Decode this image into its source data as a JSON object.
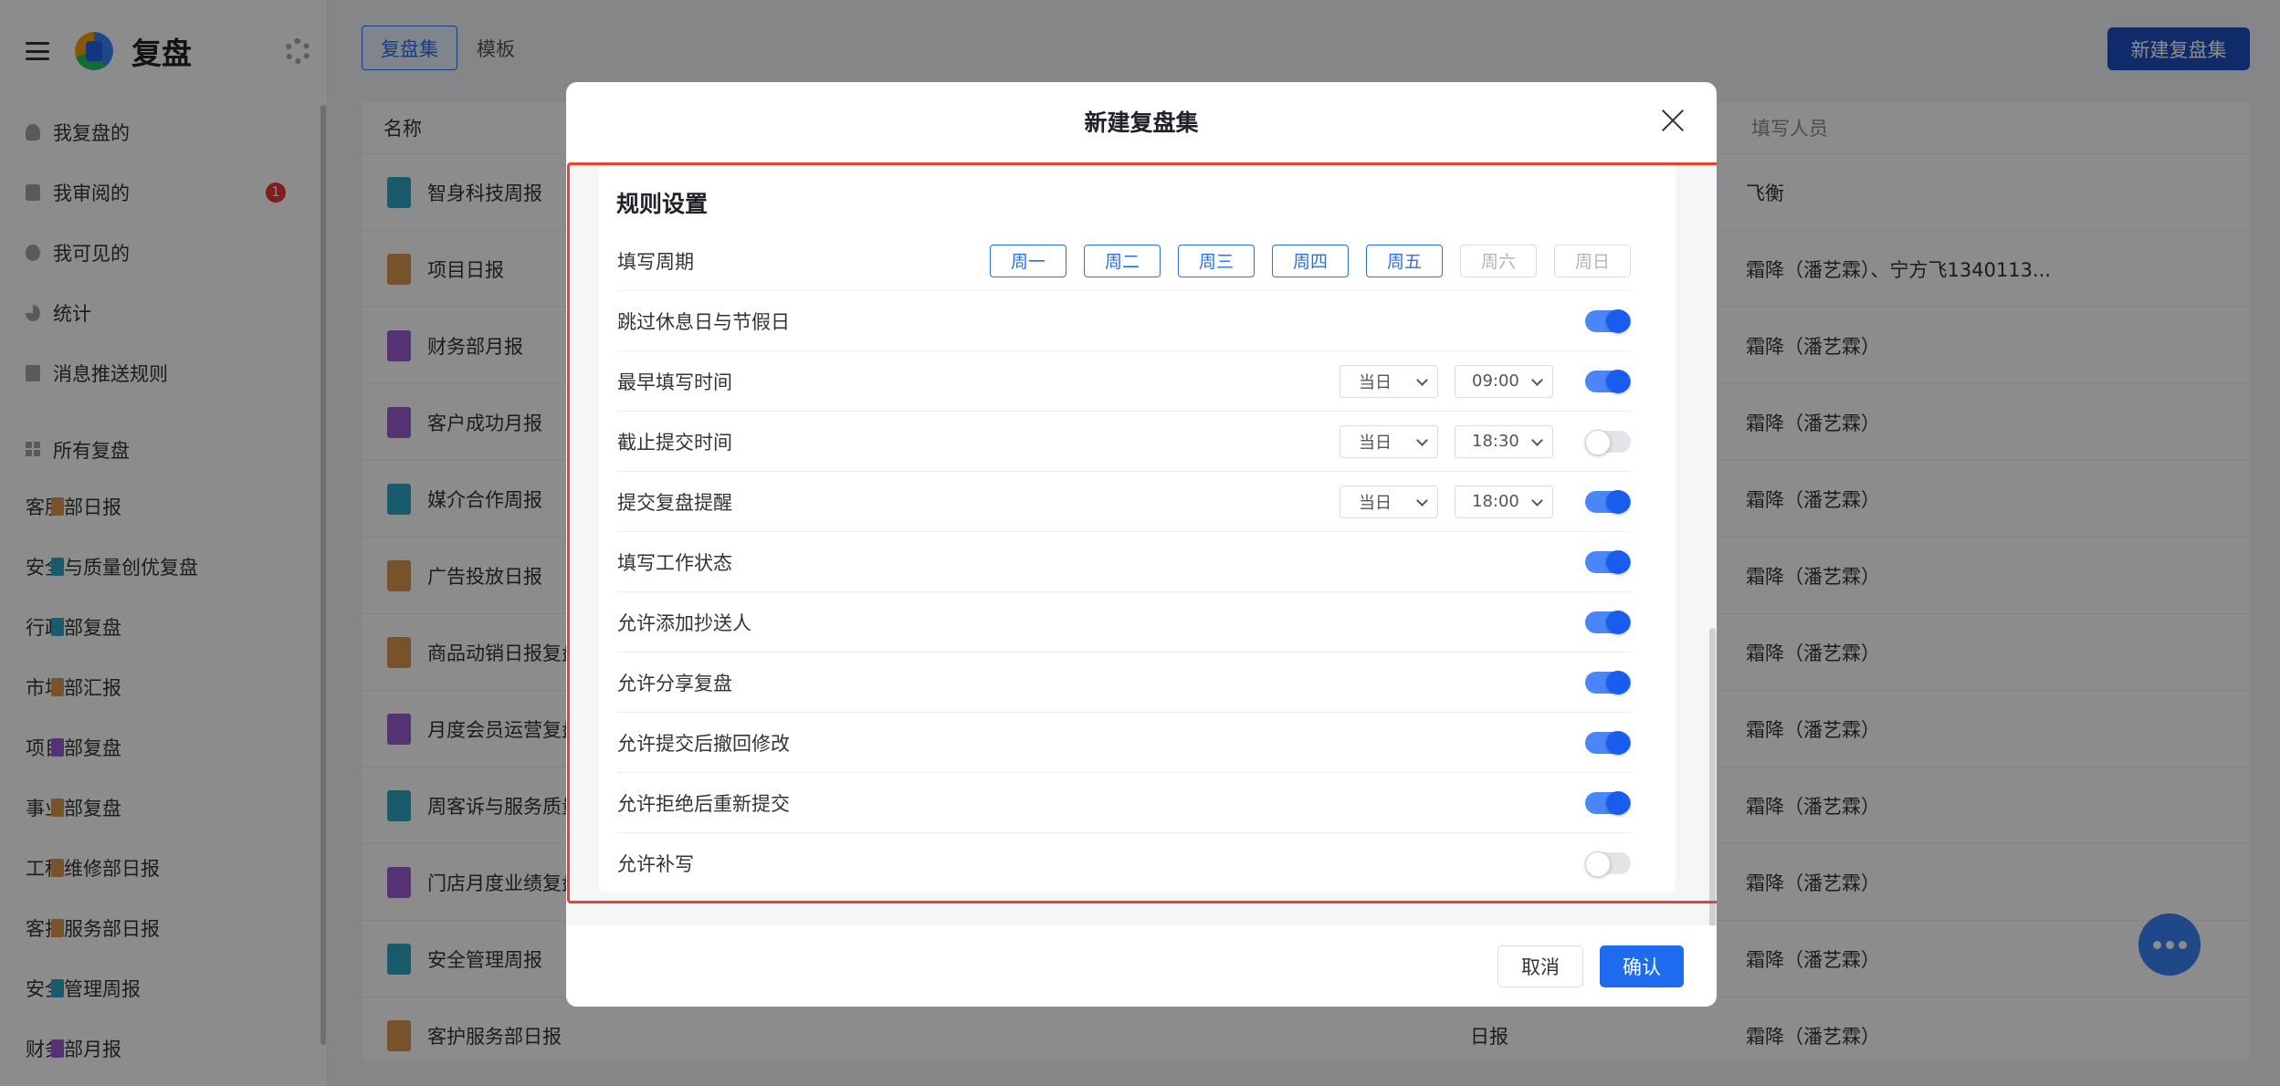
{
  "app": {
    "name": "复盘"
  },
  "sidebar": {
    "top_items": [
      {
        "label": "我复盘的",
        "icon": "person-icon"
      },
      {
        "label": "我审阅的",
        "icon": "briefcase-icon",
        "badge": "1"
      },
      {
        "label": "我可见的",
        "icon": "eye-icon"
      },
      {
        "label": "统计",
        "icon": "pie-chart-icon"
      },
      {
        "label": "消息推送规则",
        "icon": "edit-icon"
      }
    ],
    "all_label": "所有复盘",
    "groups": [
      {
        "label": "客服部日报",
        "color": "#d9954f"
      },
      {
        "label": "安全与质量创优复盘",
        "color": "#2fa6c1"
      },
      {
        "label": "行政部复盘",
        "color": "#2fa6c1"
      },
      {
        "label": "市场部汇报",
        "color": "#d9954f"
      },
      {
        "label": "项目部复盘",
        "color": "#9a5bd1"
      },
      {
        "label": "事业部复盘",
        "color": "#d9954f"
      },
      {
        "label": "工程维修部日报",
        "color": "#d9954f"
      },
      {
        "label": "客护服务部日报",
        "color": "#d9954f"
      },
      {
        "label": "安全管理周报",
        "color": "#2fa6c1"
      },
      {
        "label": "财务部月报",
        "color": "#9a5bd1"
      }
    ]
  },
  "toolbar": {
    "tabs": [
      "复盘集",
      "模板"
    ],
    "new_button": "新建复盘集"
  },
  "table": {
    "headers": {
      "name": "名称",
      "filler": "填写人员"
    },
    "rows": [
      {
        "name": "智身科技周报",
        "type": "",
        "filler": "飞衡",
        "color": "#2fa6c1"
      },
      {
        "name": "项目日报",
        "type": "",
        "filler": "霜降（潘艺霖）、宁方飞1340113...",
        "color": "#d9954f"
      },
      {
        "name": "财务部月报",
        "type": "",
        "filler": "霜降（潘艺霖）",
        "color": "#9a5bd1"
      },
      {
        "name": "客户成功月报",
        "type": "",
        "filler": "霜降（潘艺霖）",
        "color": "#9a5bd1"
      },
      {
        "name": "媒介合作周报",
        "type": "",
        "filler": "霜降（潘艺霖）",
        "color": "#2fa6c1"
      },
      {
        "name": "广告投放日报",
        "type": "",
        "filler": "霜降（潘艺霖）",
        "color": "#d9954f"
      },
      {
        "name": "商品动销日报复盘",
        "type": "",
        "filler": "霜降（潘艺霖）",
        "color": "#d9954f"
      },
      {
        "name": "月度会员运营复盘",
        "type": "",
        "filler": "霜降（潘艺霖）",
        "color": "#9a5bd1"
      },
      {
        "name": "周客诉与服务质量",
        "type": "",
        "filler": "霜降（潘艺霖）",
        "color": "#2fa6c1"
      },
      {
        "name": "门店月度业绩复盘",
        "type": "",
        "filler": "霜降（潘艺霖）",
        "color": "#9a5bd1"
      },
      {
        "name": "安全管理周报",
        "type": "",
        "filler": "霜降（潘艺霖）",
        "color": "#2fa6c1"
      },
      {
        "name": "客护服务部日报",
        "type": "日报",
        "filler": "霜降（潘艺霖）",
        "color": "#d9954f"
      }
    ]
  },
  "modal": {
    "title": "新建复盘集",
    "section_title": "规则设置",
    "period_label": "填写周期",
    "days": [
      {
        "label": "周一",
        "selected": true
      },
      {
        "label": "周二",
        "selected": true
      },
      {
        "label": "周三",
        "selected": true
      },
      {
        "label": "周四",
        "selected": true
      },
      {
        "label": "周五",
        "selected": true
      },
      {
        "label": "周六",
        "selected": false
      },
      {
        "label": "周日",
        "selected": false
      }
    ],
    "settings": [
      {
        "label": "跳过休息日与节假日",
        "on": true
      },
      {
        "label": "最早填写时间",
        "on": true,
        "day": "当日",
        "time": "09:00"
      },
      {
        "label": "截止提交时间",
        "on": false,
        "day": "当日",
        "time": "18:30"
      },
      {
        "label": "提交复盘提醒",
        "on": true,
        "day": "当日",
        "time": "18:00"
      },
      {
        "label": "填写工作状态",
        "on": true
      },
      {
        "label": "允许添加抄送人",
        "on": true
      },
      {
        "label": "允许分享复盘",
        "on": true
      },
      {
        "label": "允许提交后撤回修改",
        "on": true
      },
      {
        "label": "允许拒绝后重新提交",
        "on": true
      },
      {
        "label": "允许补写",
        "on": false
      }
    ],
    "cancel": "取消",
    "confirm": "确认"
  },
  "colors": {
    "accent": "#1f6bf0",
    "highlight": "#e5432e"
  }
}
